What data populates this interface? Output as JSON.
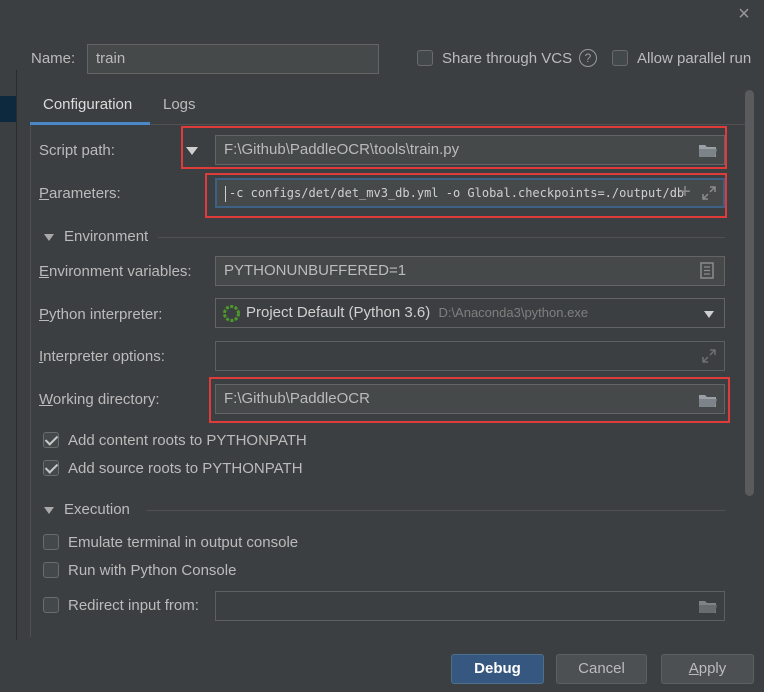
{
  "dialog": {
    "close_glyph": "×"
  },
  "header": {
    "name_label": "Name:",
    "name_value": "train",
    "share_vcs_label": "Share through VCS",
    "help_glyph": "?",
    "allow_parallel_label": "Allow parallel run"
  },
  "tabs": [
    {
      "label": "Configuration",
      "active": true
    },
    {
      "label": "Logs",
      "active": false
    }
  ],
  "config": {
    "script_path_label": "Script path:",
    "script_path_value": "F:\\Github\\PaddleOCR\\tools\\train.py",
    "parameters_label": "Parameters:",
    "parameters_value": "-c configs/det/det_mv3_db.yml -o Global.checkpoints=./output/db",
    "environment_section": "Environment",
    "env_vars_label": "Environment variables:",
    "env_vars_value": "PYTHONUNBUFFERED=1",
    "interpreter_label": "Python interpreter:",
    "interpreter_value": "Project Default (Python 3.6)",
    "interpreter_path": "D:\\Anaconda3\\python.exe",
    "interpreter_options_label": "Interpreter options:",
    "interpreter_options_value": "",
    "working_dir_label": "Working directory:",
    "working_dir_value": "F:\\Github\\PaddleOCR",
    "add_content_roots_label": "Add content roots to PYTHONPATH",
    "add_content_roots_checked": true,
    "add_source_roots_label": "Add source roots to PYTHONPATH",
    "add_source_roots_checked": true,
    "execution_section": "Execution",
    "emulate_terminal_label": "Emulate terminal in output console",
    "run_console_label": "Run with Python Console",
    "redirect_input_label": "Redirect input from:",
    "redirect_input_value": ""
  },
  "footer": {
    "debug_label": "Debug",
    "cancel_label": "Cancel",
    "apply_label": "Apply"
  },
  "colors": {
    "background": "#3c3f41",
    "field": "#45494a",
    "highlight_box": "#e03b3b",
    "primary_button": "#365880",
    "tab_underline": "#4a88c7"
  }
}
